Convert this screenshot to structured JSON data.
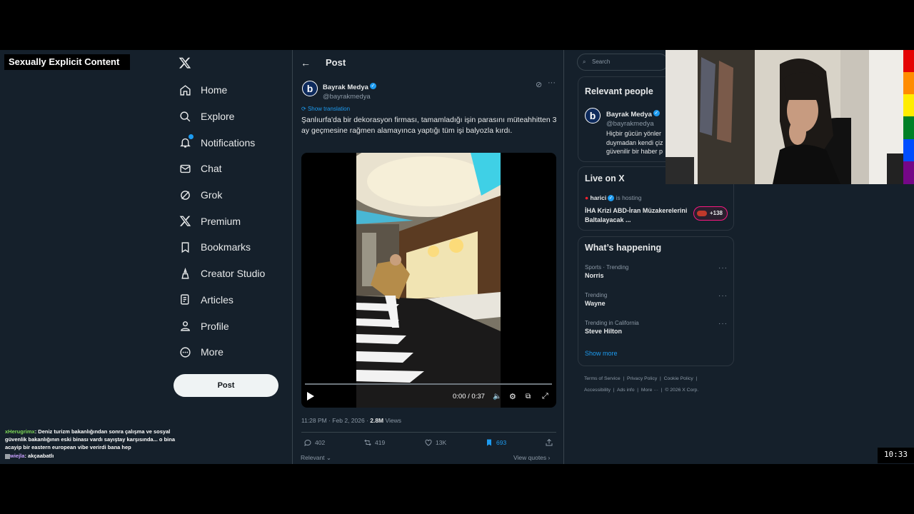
{
  "overlay": {
    "content_warning": "Sexually Explicit Content",
    "clock": "10:33"
  },
  "sidebar": {
    "logo": "X",
    "items": [
      {
        "label": "Home",
        "icon": "home-icon"
      },
      {
        "label": "Explore",
        "icon": "search-icon"
      },
      {
        "label": "Notifications",
        "icon": "bell-icon"
      },
      {
        "label": "Chat",
        "icon": "mail-icon"
      },
      {
        "label": "Grok",
        "icon": "grok-icon"
      },
      {
        "label": "Premium",
        "icon": "x-icon"
      },
      {
        "label": "Bookmarks",
        "icon": "bookmark-icon"
      },
      {
        "label": "Creator Studio",
        "icon": "creator-icon"
      },
      {
        "label": "Articles",
        "icon": "articles-icon"
      },
      {
        "label": "Profile",
        "icon": "profile-icon"
      },
      {
        "label": "More",
        "icon": "more-circle-icon"
      }
    ],
    "post_button": "Post"
  },
  "header": {
    "back": "←",
    "title": "Post"
  },
  "tweet": {
    "author_name": "Bayrak Medya",
    "author_handle": "@bayrakmedya",
    "avatar_letter": "b",
    "show_translation": "Show translation",
    "text": "Şanlıurfa'da bir dekorasyon firması, tamamladığı işin parasını müteahhitten 3 ay geçmesine rağmen alamayınca yaptığı tüm işi balyozla kırdı.",
    "video_time": "0:00 / 0:37",
    "timestamp": "11:28 PM · Feb 2, 2026 · ",
    "views_count": "2.8M",
    "views_label": " Views",
    "replies": "402",
    "reposts": "419",
    "likes": "13K",
    "bookmarks": "693",
    "sort_label": "Relevant",
    "view_quotes": "View quotes"
  },
  "right": {
    "search_placeholder": "Search",
    "relevant_people": {
      "title": "Relevant people",
      "name": "Bayrak Medya",
      "handle": "@bayrakmedya",
      "bio_lines": [
        "Hiçbir gücün yönler",
        "duymadan kendi çiz",
        "güvenilir bir haber p"
      ]
    },
    "live": {
      "title": "Live on X",
      "host": "harici",
      "hosting": "is hosting",
      "topic": "İHA Krizi ABD-İran Müzakerelerini Baltalayacak ...",
      "listeners": "+138"
    },
    "happening": {
      "title": "What’s happening",
      "trends": [
        {
          "context": "Sports · Trending",
          "name": "Norris"
        },
        {
          "context": "Trending",
          "name": "Wayne"
        },
        {
          "context": "Trending in California",
          "name": "Steve Hilton"
        }
      ],
      "show_more": "Show more"
    },
    "footer": {
      "links": [
        "Terms of Service",
        "Privacy Policy",
        "Cookie Policy",
        "Accessibility",
        "Ads info",
        "More ···"
      ],
      "copyright": "© 2026 X Corp."
    }
  },
  "chat": [
    {
      "user": "xHerugrimx",
      "message": "Deniz turizm bakanlığından sonra çalışma ve sosyal güvenlik bakanlığının eski binası vardı sayıştay karşısında... o bina acayip bir eastern european vibe verirdi bana hep"
    },
    {
      "user": "wiejla",
      "message": "akçaabatlı"
    }
  ],
  "colors": {
    "background": "#15202b",
    "accent": "#1d9bf0",
    "text": "#e7e9ea",
    "muted": "#8b98a5"
  }
}
